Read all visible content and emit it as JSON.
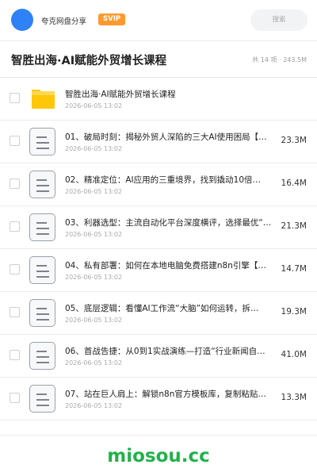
{
  "header": {
    "site_name": "夸克网盘分享",
    "badge": "SVIP",
    "search_placeholder": "搜索"
  },
  "titlebar": {
    "title": "智胜出海·AI赋能外贸增长课程",
    "summary": "共 14 项 · 243.5M"
  },
  "items": [
    {
      "type": "folder",
      "icon": "folder-icon",
      "name": "智胜出海·AI赋能外贸增长课程",
      "date": "2026-06-05 13:02",
      "size": ""
    },
    {
      "type": "file",
      "icon": "document-icon",
      "name": "01、破局时刻：揭秘外贸人深陷的三大AI使用困局【…",
      "date": "2026-06-05 13:02",
      "size": "23.3M"
    },
    {
      "type": "file",
      "icon": "document-icon",
      "name": "02、精准定位：AI应用的三重境界，找到撬动10倍…",
      "date": "2026-06-05 13:02",
      "size": "16.4M"
    },
    {
      "type": "file",
      "icon": "document-icon",
      "name": "03、利器选型：主流自动化平台深度横评，选择最优“…",
      "date": "2026-06-05 13:02",
      "size": "21.3M"
    },
    {
      "type": "file",
      "icon": "document-icon",
      "name": "04、私有部署：如何在本地电脑免费搭建n8n引擎【…",
      "date": "2026-06-05 13:02",
      "size": "14.7M"
    },
    {
      "type": "file",
      "icon": "document-icon",
      "name": "05、底层逻辑：看懂AI工作流“大脑”如何运转，拆…",
      "date": "2026-06-05 13:02",
      "size": "19.3M"
    },
    {
      "type": "file",
      "icon": "document-icon",
      "name": "06、首战告捷：从0到1实战演练—打造“行业新闻自…",
      "date": "2026-06-05 13:02",
      "size": "41.0M"
    },
    {
      "type": "file",
      "icon": "document-icon",
      "name": "07、站在巨人肩上：解锁n8n官方模板库，复制粘贴…",
      "date": "2026-06-05 13:02",
      "size": "13.3M"
    }
  ],
  "footer": {
    "brand": "miosou.cc"
  },
  "colors": {
    "accent_blue": "#2e82f5",
    "svip_orange": "#ff9a2e",
    "folder_yellow": "#ffc60a",
    "brand_green": "#22b14c"
  }
}
